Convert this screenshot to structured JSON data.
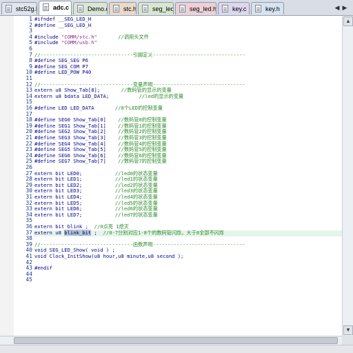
{
  "tabs": [
    {
      "label": "stc52g.h",
      "color": "#dfe4ee",
      "active": false
    },
    {
      "label": "adc.c",
      "color": "#8fb7c9",
      "active": true
    },
    {
      "label": "Demo.c",
      "color": "#d9e6d3",
      "active": false
    },
    {
      "label": "stc.h",
      "color": "#e9d9c6",
      "active": false
    },
    {
      "label": "seg_led.c",
      "color": "#d8e6d0",
      "active": false
    },
    {
      "label": "seg_led.h*",
      "color": "#eed0d6",
      "active": false
    },
    {
      "label": "key.c",
      "color": "#dcd6ee",
      "active": false
    },
    {
      "label": "key.h",
      "color": "#d7e3f0",
      "active": false
    }
  ],
  "tab_nav": {
    "left": "◀",
    "right": "▶",
    "close": "×"
  },
  "line_numbers": [
    "1",
    "2",
    "3",
    "4",
    "5",
    "6",
    "7",
    "8",
    "9",
    "10",
    "11",
    "12",
    "13",
    "14",
    "15",
    "16",
    "17",
    "18",
    "19",
    "20",
    "21",
    "22",
    "23",
    "24",
    "25",
    "26",
    "27",
    "28",
    "29",
    "30",
    "31",
    "32",
    "33",
    "34",
    "35",
    "36",
    "37",
    "38",
    "39",
    "40",
    "41",
    "42",
    "43",
    "44",
    "45"
  ],
  "code": [
    [
      {
        "t": "#ifndef __SEG_LED_H",
        "c": "pp"
      }
    ],
    [
      {
        "t": "#define __SEG_LED_H",
        "c": "pp"
      }
    ],
    [
      {
        "t": "",
        "c": "id"
      }
    ],
    [
      {
        "t": "#include ",
        "c": "pp"
      },
      {
        "t": "\"COMM/stc.h\"",
        "c": "str"
      },
      {
        "t": "       //调用头文件",
        "c": "cm"
      }
    ],
    [
      {
        "t": "#include ",
        "c": "pp"
      },
      {
        "t": "\"COMM/usb.h\"",
        "c": "str"
      }
    ],
    [
      {
        "t": "",
        "c": "id"
      }
    ],
    [
      {
        "t": "//-------------------------------引脚定义-------------------------------",
        "c": "cm"
      }
    ],
    [
      {
        "t": "#define SEG_SEG P6",
        "c": "pp"
      }
    ],
    [
      {
        "t": "#define SEG_COM P7",
        "c": "pp"
      }
    ],
    [
      {
        "t": "#define LED_POW P40",
        "c": "pp"
      }
    ],
    [
      {
        "t": "",
        "c": "id"
      }
    ],
    [
      {
        "t": "//-------------------------------变量声明-------------------------------",
        "c": "cm"
      }
    ],
    [
      {
        "t": "extern u8 Show_Tab[8];",
        "c": "kw"
      },
      {
        "t": "       //数码管的显示的变量",
        "c": "cm"
      }
    ],
    [
      {
        "t": "extern u8 bdata LED_DATA;",
        "c": "kw"
      },
      {
        "t": "          //led的显示的变量",
        "c": "cm"
      }
    ],
    [
      {
        "t": "",
        "c": "id"
      }
    ],
    [
      {
        "t": "#define LED LED_DATA",
        "c": "pp"
      },
      {
        "t": "       //8个LED的控制变量",
        "c": "cm"
      }
    ],
    [
      {
        "t": "",
        "c": "id"
      }
    ],
    [
      {
        "t": "#define SEG0 Show_Tab[0]",
        "c": "pp"
      },
      {
        "t": "    //数码管0的控制变量",
        "c": "cm"
      }
    ],
    [
      {
        "t": "#define SEG1 Show_Tab[1]",
        "c": "pp"
      },
      {
        "t": "    //数码管1的控制变量",
        "c": "cm"
      }
    ],
    [
      {
        "t": "#define SEG2 Show_Tab[2]",
        "c": "pp"
      },
      {
        "t": "    //数码管2的控制变量",
        "c": "cm"
      }
    ],
    [
      {
        "t": "#define SEG3 Show_Tab[3]",
        "c": "pp"
      },
      {
        "t": "    //数码管3的控制变量",
        "c": "cm"
      }
    ],
    [
      {
        "t": "#define SEG4 Show_Tab[4]",
        "c": "pp"
      },
      {
        "t": "    //数码管4的控制变量",
        "c": "cm"
      }
    ],
    [
      {
        "t": "#define SEG5 Show_Tab[5]",
        "c": "pp"
      },
      {
        "t": "    //数码管5的控制变量",
        "c": "cm"
      }
    ],
    [
      {
        "t": "#define SEG6 Show_Tab[6]",
        "c": "pp"
      },
      {
        "t": "    //数码管6的控制变量",
        "c": "cm"
      }
    ],
    [
      {
        "t": "#define SEG7 Show_Tab[7]",
        "c": "pp"
      },
      {
        "t": "    //数码管7的控制变量",
        "c": "cm"
      }
    ],
    [
      {
        "t": "",
        "c": "id"
      }
    ],
    [
      {
        "t": "extern bit LED0;",
        "c": "kw"
      },
      {
        "t": "           //led0的状态变量",
        "c": "cm"
      }
    ],
    [
      {
        "t": "extern bit LED1;",
        "c": "kw"
      },
      {
        "t": "           //led1的状态变量",
        "c": "cm"
      }
    ],
    [
      {
        "t": "extern bit LED2;",
        "c": "kw"
      },
      {
        "t": "           //led2的状态变量",
        "c": "cm"
      }
    ],
    [
      {
        "t": "extern bit LED3;",
        "c": "kw"
      },
      {
        "t": "           //led3的状态变量",
        "c": "cm"
      }
    ],
    [
      {
        "t": "extern bit LED4;",
        "c": "kw"
      },
      {
        "t": "           //led4的状态变量",
        "c": "cm"
      }
    ],
    [
      {
        "t": "extern bit LED5;",
        "c": "kw"
      },
      {
        "t": "           //led5的状态变量",
        "c": "cm"
      }
    ],
    [
      {
        "t": "extern bit LED6;",
        "c": "kw"
      },
      {
        "t": "           //led6的状态变量",
        "c": "cm"
      }
    ],
    [
      {
        "t": "extern bit LED7;",
        "c": "kw"
      },
      {
        "t": "           //led7的状态变量",
        "c": "cm"
      }
    ],
    [
      {
        "t": "",
        "c": "id"
      }
    ],
    [
      {
        "t": "extern bit blink ;",
        "c": "kw"
      },
      {
        "t": "  //0点亮 1熄灭",
        "c": "cm"
      }
    ],
    [
      {
        "t": "extern u8 ",
        "c": "kw"
      },
      {
        "t": "blink_bit",
        "c": "hl"
      },
      {
        "t": " ;",
        "c": "kw"
      },
      {
        "t": "  //0-7分别对应1-8个的数码管闪烁，大于8全部不闪烁",
        "c": "cm"
      }
    ],
    [
      {
        "t": "",
        "c": "id"
      }
    ],
    [
      {
        "t": "//-------------------------------函数声明-------------------------------",
        "c": "cm"
      }
    ],
    [
      {
        "t": "void SEG_LED_Show( void ) ;",
        "c": "kw"
      }
    ],
    [
      {
        "t": "void Clock_InitShow(u8 hour,u8 minute,u8 second );",
        "c": "kw"
      }
    ],
    [
      {
        "t": "",
        "c": "id"
      }
    ],
    [
      {
        "t": "#endif",
        "c": "pp"
      }
    ],
    [
      {
        "t": "",
        "c": "id"
      }
    ],
    [
      {
        "t": "",
        "c": "id"
      }
    ]
  ],
  "current_line_index": 36
}
